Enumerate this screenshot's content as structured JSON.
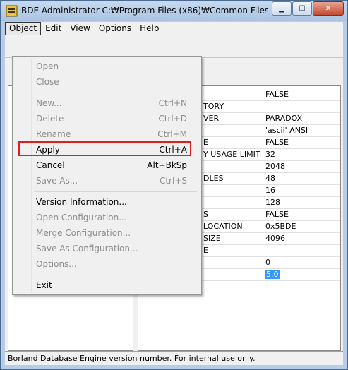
{
  "window": {
    "title": "BDE Administrator   C:₩Program Files (x86)₩Common Files₩Bo..."
  },
  "menubar": {
    "object": "Object",
    "edit": "Edit",
    "view": "View",
    "options": "Options",
    "help": "Help"
  },
  "object_menu": {
    "open": "Open",
    "close": "Close",
    "new": "New...",
    "new_sc": "Ctrl+N",
    "delete": "Delete",
    "delete_sc": "Ctrl+D",
    "rename": "Rename",
    "rename_sc": "Ctrl+M",
    "apply": "Apply",
    "apply_sc": "Ctrl+A",
    "cancel": "Cancel",
    "cancel_sc": "Alt+BkSp",
    "save_as": "Save As...",
    "save_as_sc": "Ctrl+S",
    "version_info": "Version Information...",
    "open_config": "Open Configuration...",
    "merge_config": "Merge Configuration...",
    "save_as_config": "Save As Configuration...",
    "options": "Options...",
    "exit": "Exit"
  },
  "grid": {
    "rows": [
      {
        "k": "",
        "v": "FALSE"
      },
      {
        "k": "TORY",
        "v": ""
      },
      {
        "k": "VER",
        "v": "PARADOX"
      },
      {
        "k": "",
        "v": "'ascii' ANSI"
      },
      {
        "k": "E",
        "v": "FALSE"
      },
      {
        "k": "Y USAGE LIMIT",
        "v": "32"
      },
      {
        "k": "",
        "v": "2048"
      },
      {
        "k": "DLES",
        "v": "48"
      },
      {
        "k": "",
        "v": "16"
      },
      {
        "k": "",
        "v": "128"
      },
      {
        "k": "S",
        "v": "FALSE"
      },
      {
        "k": "LOCATION",
        "v": "0x5BDE"
      },
      {
        "k": "SIZE",
        "v": "4096"
      },
      {
        "k": "E",
        "v": ""
      },
      {
        "k": "",
        "v": "0"
      },
      {
        "k": "",
        "v": "5.0"
      }
    ]
  },
  "status": {
    "text": "Borland Database Engine version number.  For internal use only."
  },
  "colors": {
    "highlight_box": "#e02020",
    "selection": "#3399ff"
  }
}
